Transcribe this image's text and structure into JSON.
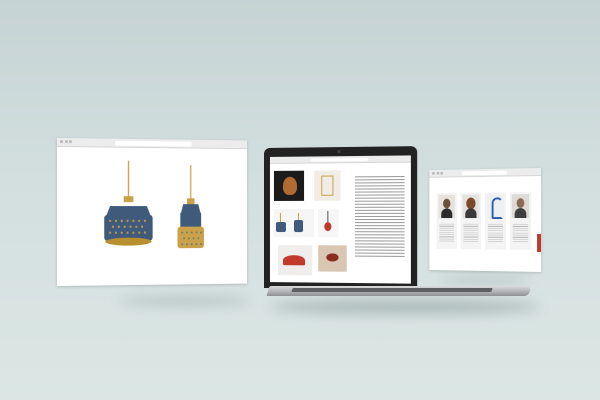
{
  "colors": {
    "background": "#ccd9d9",
    "lamp_blue": "#3f5a7a",
    "lamp_gold": "#c9a24a",
    "accent_red": "#c0392b"
  },
  "left_window": {
    "url": "",
    "site_title": "",
    "nav": ""
  },
  "laptop": {
    "site_title": "",
    "heading": ""
  },
  "right_window": {
    "site_title": "",
    "heading": "",
    "team": [
      {
        "name": "",
        "icon": "portrait-man-beard"
      },
      {
        "name": "",
        "icon": "portrait-woman"
      },
      {
        "name": "",
        "icon": "blue-sculpture"
      },
      {
        "name": "",
        "icon": "portrait-man-bald"
      }
    ]
  }
}
